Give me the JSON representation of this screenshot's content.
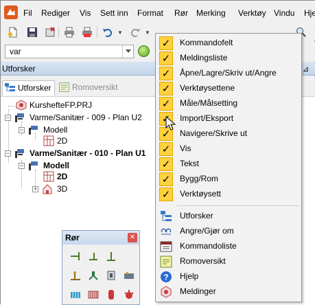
{
  "menubar": {
    "items": [
      "Fil",
      "Rediger",
      "Vis",
      "Sett inn",
      "Format",
      "Rør",
      "Merking",
      "Verktøy",
      "Vindu",
      "Hjelp"
    ]
  },
  "toolbar": {
    "buttons": [
      "new-icon",
      "open-icon",
      "save-icon",
      "close-doc-icon",
      "print-icon",
      "print-preview-icon",
      "undo-icon",
      "redo-icon"
    ]
  },
  "command": {
    "value": "var"
  },
  "explorer": {
    "title": "Utforsker",
    "tabs": [
      {
        "label": "Utforsker",
        "active": true
      },
      {
        "label": "Romoversikt",
        "active": false
      }
    ],
    "tree": {
      "project": "KurshefteFP.PRJ",
      "drawing1": "Varme/Sanitær - 009 - Plan U2",
      "model1": "Modell",
      "view1_2d": "2D",
      "drawing2": "Varme/Sanitær - 010 - Plan U1",
      "model2": "Modell",
      "view2_2d": "2D",
      "view2_3d": "3D"
    }
  },
  "ror_toolbox": {
    "title": "Rør"
  },
  "context_menu": {
    "checked_items": [
      "Kommandofelt",
      "Meldingsliste",
      "Åpne/Lagre/Skriv ut/Angre",
      "Verktøysettene",
      "Måle/Målsetting",
      "Import/Eksport",
      "Navigere/Skrive ut",
      "Vis",
      "Tekst",
      "Bygg/Rom",
      "Verktøysett"
    ],
    "panel_items": [
      {
        "label": "Utforsker",
        "icon": "explorer-icon"
      },
      {
        "label": "Angre/Gjør om",
        "icon": "undo-redo-icon"
      },
      {
        "label": "Kommandoliste",
        "icon": "command-list-icon"
      },
      {
        "label": "Romoversikt",
        "icon": "room-overview-icon"
      },
      {
        "label": "Hjelp",
        "icon": "help-icon"
      },
      {
        "label": "Meldinger",
        "icon": "messages-icon"
      }
    ]
  },
  "colors": {
    "check_bg": "#ffd13b",
    "panel_header": "#c3d4ea",
    "ok_green": "#5aa41a"
  }
}
